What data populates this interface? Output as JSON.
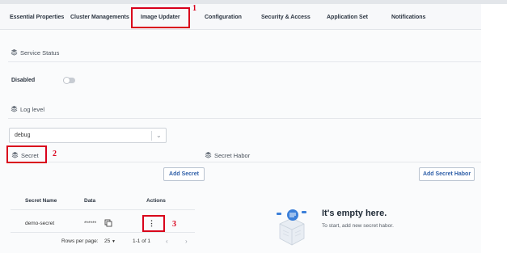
{
  "tabs": [
    {
      "label": "Essential Properties"
    },
    {
      "label": "Cluster Managements"
    },
    {
      "label": "Image Updater"
    },
    {
      "label": "Configuration"
    },
    {
      "label": "Security & Access"
    },
    {
      "label": "Application Set"
    },
    {
      "label": "Notifications"
    }
  ],
  "service_status": {
    "title": "Service Status",
    "toggle_label": "Disabled",
    "enabled": false
  },
  "log_level": {
    "title": "Log level",
    "value": "debug"
  },
  "secret": {
    "title": "Secret",
    "add_button": "Add Secret",
    "columns": [
      "Secret Name",
      "Data",
      "Actions"
    ],
    "rows": [
      {
        "name": "demo-secret",
        "data": "******"
      }
    ],
    "pagination": {
      "rows_per_page_label": "Rows per page:",
      "rows_per_page": "25",
      "range": "1-1 of 1"
    }
  },
  "secret_habor": {
    "title": "Secret Habor",
    "add_button": "Add Secret Habor",
    "empty_title": "It's empty here.",
    "empty_subtitle": "To start, add new secret habor."
  },
  "annotations": [
    "1",
    "2",
    "3"
  ],
  "colors": {
    "annotation": "#d9001b",
    "accent": "#2f5fa8",
    "empty_illustration": "#3b7fd9"
  }
}
